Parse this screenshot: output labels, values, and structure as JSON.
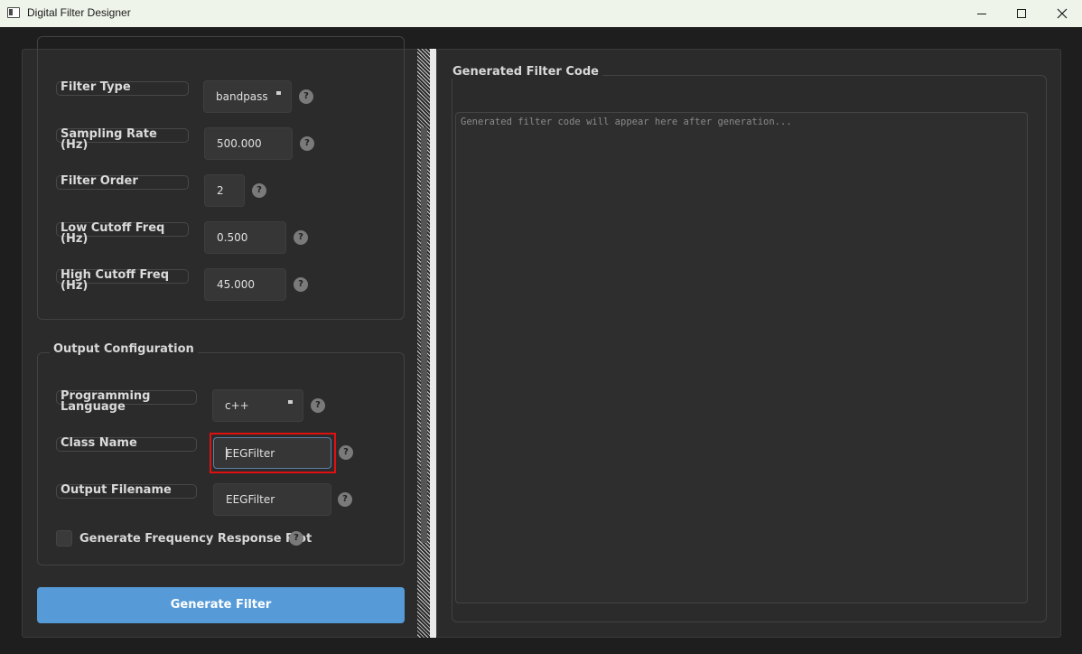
{
  "window": {
    "title": "Digital Filter Designer"
  },
  "filter_params": {
    "filter_type_label": "Filter Type",
    "filter_type_value": "bandpass",
    "sampling_rate_label": "Sampling Rate (Hz)",
    "sampling_rate_value": "500.000",
    "filter_order_label": "Filter Order",
    "filter_order_value": "2",
    "low_cutoff_label": "Low Cutoff Freq (Hz)",
    "low_cutoff_value": "0.500",
    "high_cutoff_label": "High Cutoff Freq (Hz)",
    "high_cutoff_value": "45.000"
  },
  "output_config": {
    "group_title": "Output Configuration",
    "language_label": "Programming Language",
    "language_value": "c++",
    "class_name_label": "Class Name",
    "class_name_value": "EEGFilter",
    "filename_label": "Output Filename",
    "filename_value": "EEGFilter",
    "plot_checkbox_label": "Generate Frequency Response Plot",
    "plot_checkbox_checked": false
  },
  "help_glyph": "?",
  "generate_button": "Generate Filter",
  "code_panel": {
    "title": "Generated Filter Code",
    "placeholder": "Generated filter code will appear here after generation..."
  },
  "colors": {
    "accent": "#569bd8",
    "highlight": "#e01010",
    "background": "#2b2b2b"
  }
}
